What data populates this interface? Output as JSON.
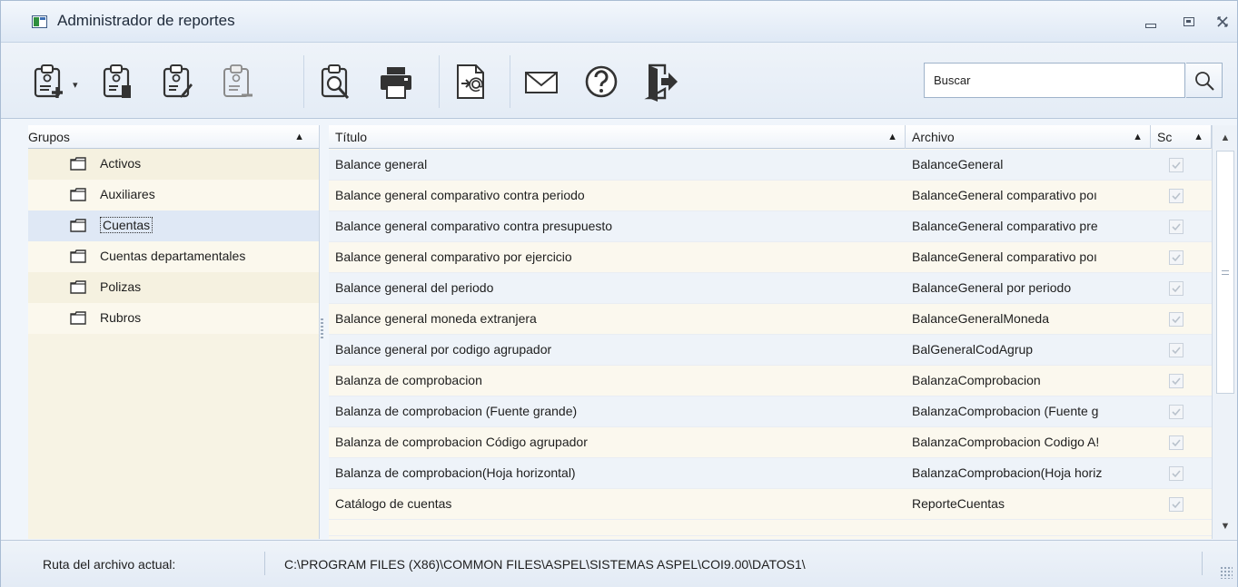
{
  "window": {
    "title": "Administrador de reportes"
  },
  "toolbar": {
    "buttons": [
      {
        "icon": "new-report-icon"
      },
      {
        "icon": "edit-report-icon"
      },
      {
        "icon": "modify-report-icon"
      },
      {
        "icon": "delete-report-icon"
      },
      {
        "icon": "preview-icon"
      },
      {
        "icon": "print-icon"
      },
      {
        "icon": "export-email-icon"
      },
      {
        "icon": "mail-icon"
      },
      {
        "icon": "help-icon"
      },
      {
        "icon": "exit-icon"
      }
    ],
    "search": {
      "value": "Buscar"
    }
  },
  "groups": {
    "header": "Grupos",
    "items": [
      {
        "label": "Activos"
      },
      {
        "label": "Auxiliares"
      },
      {
        "label": "Cuentas",
        "selected": true
      },
      {
        "label": "Cuentas departamentales"
      },
      {
        "label": "Polizas"
      },
      {
        "label": "Rubros"
      }
    ]
  },
  "grid": {
    "headers": {
      "titulo": "Título",
      "archivo": "Archivo",
      "sc": "Sc"
    },
    "rows": [
      {
        "titulo": "Balance general",
        "archivo": "BalanceGeneral",
        "checked": true
      },
      {
        "titulo": "Balance general comparativo contra periodo",
        "archivo": "BalanceGeneral comparativo poı",
        "checked": true
      },
      {
        "titulo": "Balance general comparativo contra presupuesto",
        "archivo": "BalanceGeneral comparativo pre",
        "checked": true
      },
      {
        "titulo": "Balance general comparativo por ejercicio",
        "archivo": "BalanceGeneral comparativo poı",
        "checked": true
      },
      {
        "titulo": "Balance general del periodo",
        "archivo": "BalanceGeneral por periodo",
        "checked": true
      },
      {
        "titulo": "Balance general moneda extranjera",
        "archivo": "BalanceGeneralMoneda",
        "checked": true
      },
      {
        "titulo": "Balance general por codigo agrupador",
        "archivo": "BalGeneralCodAgrup",
        "checked": true
      },
      {
        "titulo": "Balanza de comprobacion",
        "archivo": "BalanzaComprobacion",
        "checked": true
      },
      {
        "titulo": "Balanza de comprobacion (Fuente grande)",
        "archivo": "BalanzaComprobacion (Fuente g",
        "checked": true
      },
      {
        "titulo": "Balanza de comprobacion Código agrupador",
        "archivo": "BalanzaComprobacion Codigo A!",
        "checked": true
      },
      {
        "titulo": "Balanza de comprobacion(Hoja horizontal)",
        "archivo": "BalanzaComprobacion(Hoja horiz",
        "checked": true
      },
      {
        "titulo": "Catálogo de cuentas",
        "archivo": "ReporteCuentas",
        "checked": true
      }
    ]
  },
  "status": {
    "label": "Ruta del archivo actual:",
    "path": "C:\\PROGRAM FILES (X86)\\COMMON FILES\\ASPEL\\SISTEMAS ASPEL\\COI9.00\\DATOS1\\"
  }
}
